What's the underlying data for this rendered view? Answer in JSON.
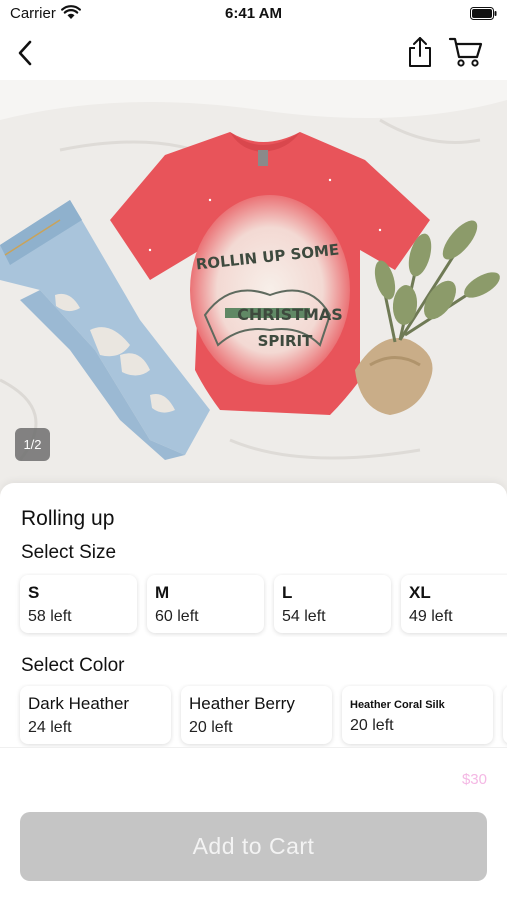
{
  "status_bar": {
    "carrier": "Carrier",
    "time": "6:41 AM"
  },
  "nav": {
    "back_icon": "chevron-left-icon",
    "share_icon": "share-icon",
    "cart_icon": "cart-icon"
  },
  "product_image": {
    "page_indicator": "1/2",
    "shirt_graphic_line1": "ROLLIN UP SOME",
    "shirt_graphic_line2": "CHRISTMAS",
    "shirt_graphic_line3": "SPIRIT"
  },
  "product": {
    "title": "Rolling up",
    "price": "$30"
  },
  "size_section": {
    "label": "Select Size",
    "options": [
      {
        "name": "S",
        "stock": "58 left"
      },
      {
        "name": "M",
        "stock": "60 left"
      },
      {
        "name": "L",
        "stock": "54 left"
      },
      {
        "name": "XL",
        "stock": "49 left"
      }
    ]
  },
  "color_section": {
    "label": "Select Color",
    "options": [
      {
        "name": "Dark Heather",
        "stock": "24 left"
      },
      {
        "name": "Heather Berry",
        "stock": "20 left"
      },
      {
        "name": "Heather Coral Silk",
        "stock": "20 left"
      }
    ]
  },
  "cart_button": {
    "label": "Add to Cart"
  },
  "colors": {
    "button_disabled": "#c5c5c5",
    "price_text": "#f4b8e4",
    "shirt": "#e8545a"
  }
}
